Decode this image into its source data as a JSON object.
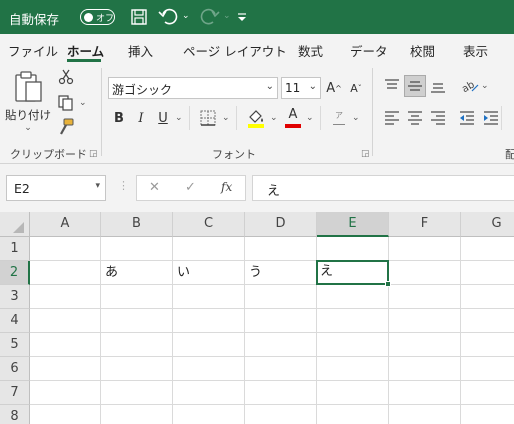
{
  "titlebar": {
    "autosave_label": "自動保存",
    "autosave_state": "オフ",
    "icons": [
      "save-icon",
      "undo-icon",
      "redo-icon",
      "customize-qat-icon"
    ]
  },
  "tabs": [
    {
      "label": "ファイル",
      "active": false
    },
    {
      "label": "ホーム",
      "active": true
    },
    {
      "label": "挿入",
      "active": false
    },
    {
      "label": "ページ レイアウト",
      "active": false
    },
    {
      "label": "数式",
      "active": false
    },
    {
      "label": "データ",
      "active": false
    },
    {
      "label": "校閲",
      "active": false
    },
    {
      "label": "表示",
      "active": false
    }
  ],
  "ribbon": {
    "clipboard": {
      "paste_label": "貼り付け",
      "group_label": "クリップボード"
    },
    "font": {
      "font_name": "游ゴシック",
      "font_size": "11",
      "bold": "B",
      "italic": "I",
      "underline": "U",
      "font_color_glyph": "A",
      "grow_glyph": "A",
      "shrink_glyph": "A",
      "phonetic_glyph": "ア",
      "group_label": "フォント"
    },
    "alignment": {
      "group_label_partial": "配"
    }
  },
  "formula_bar": {
    "name_box": "E2",
    "fx_label": "fx",
    "content": "え"
  },
  "sheet": {
    "columns": [
      "A",
      "B",
      "C",
      "D",
      "E",
      "F",
      "G"
    ],
    "rows": [
      "1",
      "2",
      "3",
      "4",
      "5",
      "6",
      "7",
      "8"
    ],
    "selected_cell": "E2",
    "cells": {
      "B2": "あ",
      "C2": "い",
      "D2": "う",
      "E2": "え"
    }
  },
  "colors": {
    "accent": "#217346",
    "font_color_bar": "#e00000",
    "highlight_bar": "#ffff00"
  }
}
